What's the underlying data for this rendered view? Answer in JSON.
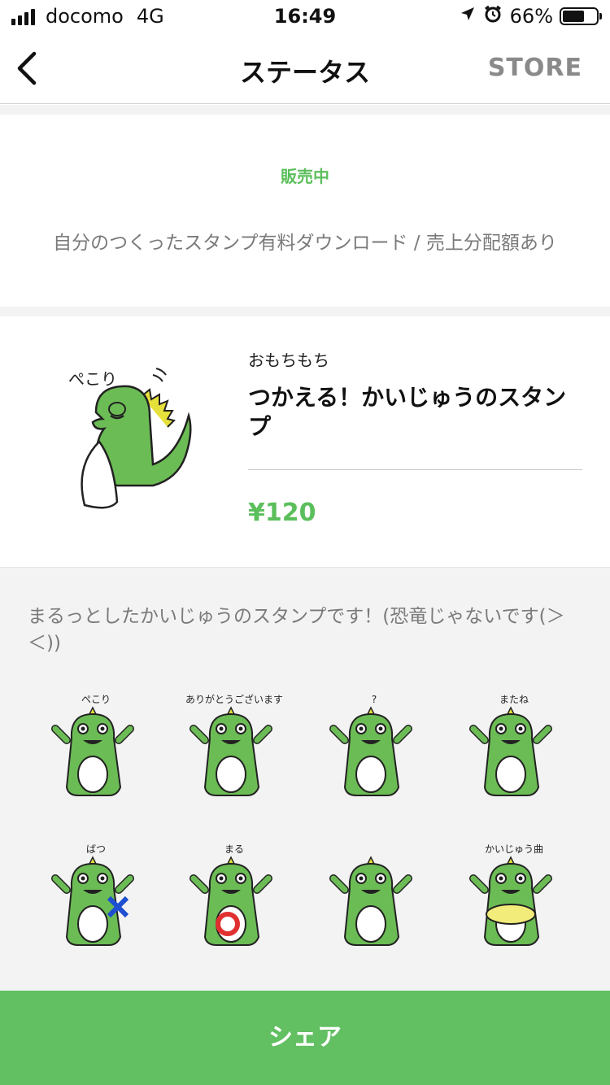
{
  "status_bar": {
    "carrier": "docomo",
    "network": "4G",
    "time": "16:49",
    "battery_text": "66%",
    "battery_level": 0.66,
    "icons": [
      "signal-icon",
      "location-arrow-icon",
      "alarm-icon",
      "battery-icon"
    ]
  },
  "nav": {
    "title": "ステータス",
    "store_label": "STORE"
  },
  "status": {
    "label": "販売中",
    "description": "自分のつくったスタンプ有料ダウンロード / 売上分配額あり"
  },
  "product": {
    "author": "おもちもち",
    "name": "つかえる！かいじゅうのスタンプ",
    "price": "¥120"
  },
  "description": "まるっとしたかいじゅうのスタンプです！(恐竜じゃないです(＞＜))",
  "stickers": [
    {
      "caption": "ぺこり"
    },
    {
      "caption": "ありがとうございます"
    },
    {
      "caption": "?"
    },
    {
      "caption": "またね"
    },
    {
      "caption": "ばつ"
    },
    {
      "caption": "まる"
    },
    {
      "caption": ""
    },
    {
      "caption": "かいじゅう曲"
    }
  ],
  "share_label": "シェア",
  "colors": {
    "accent": "#5bbf5b",
    "monster": "#6cbc55",
    "spikes": "#e6e03a"
  }
}
